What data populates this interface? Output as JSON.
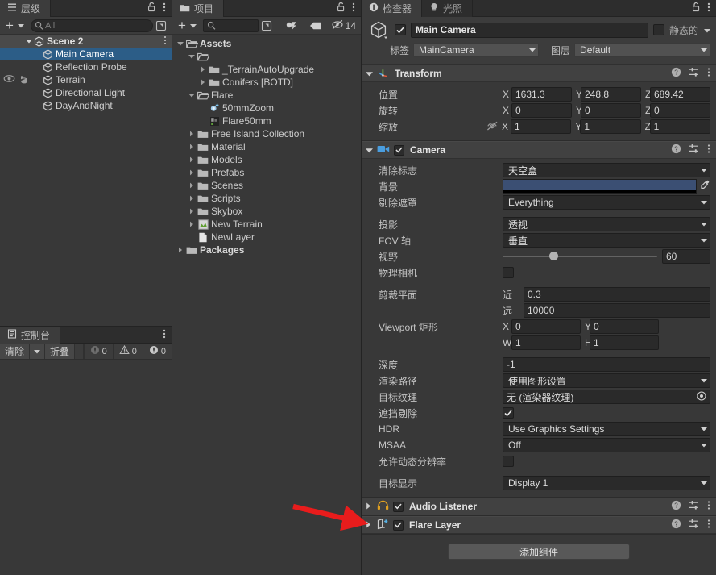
{
  "hierarchy": {
    "tab_label": "层级",
    "tab_icon": "hierarchy-icon",
    "lock_icon": "lock-open-icon",
    "menu_icon": "kebab-menu-icon",
    "add_label": "+",
    "search_placeholder": "All",
    "scene": {
      "label": "Scene 2",
      "icon": "unity-scene-icon"
    },
    "items": [
      {
        "label": "Main Camera",
        "icon": "gameobject-cube-icon",
        "selected": true,
        "vis": false
      },
      {
        "label": "Reflection Probe",
        "icon": "gameobject-cube-icon",
        "selected": false,
        "vis": false
      },
      {
        "label": "Terrain",
        "icon": "gameobject-cube-icon",
        "selected": false,
        "vis": true
      },
      {
        "label": "Directional Light",
        "icon": "gameobject-cube-icon",
        "selected": false,
        "vis": false
      },
      {
        "label": "DayAndNight",
        "icon": "gameobject-cube-icon",
        "selected": false,
        "vis": false
      }
    ]
  },
  "console": {
    "tab_label": "控制台",
    "tab_icon": "console-icon",
    "menu_icon": "kebab-menu-icon",
    "clear_label": "清除",
    "clear_dropdown_icon": "chevron-down-icon",
    "collapse_label": "折叠",
    "counters": [
      {
        "icon": "log-icon",
        "value": "0"
      },
      {
        "icon": "warning-icon",
        "value": "0"
      },
      {
        "icon": "error-icon",
        "value": "0"
      }
    ]
  },
  "project": {
    "tab_label": "项目",
    "tab_icon": "folder-icon",
    "lock_icon": "lock-open-icon",
    "menu_icon": "kebab-menu-icon",
    "add_label": "+",
    "search_placeholder": "",
    "filter_type_icon": "filter-by-type-icon",
    "filter_label_icon": "filter-by-label-icon",
    "hidden_icon": "eye-off-icon",
    "hidden_count": "14",
    "tree": [
      {
        "label": "Assets",
        "icon": "folder-open-icon",
        "indent": 0,
        "tw": "down",
        "bold": true
      },
      {
        "label": "",
        "icon": "folder-open-icon",
        "indent": 1,
        "tw": "down",
        "bold": false
      },
      {
        "label": "_TerrainAutoUpgrade",
        "icon": "folder-icon",
        "indent": 2,
        "tw": "right",
        "bold": false
      },
      {
        "label": "Conifers [BOTD]",
        "icon": "folder-icon",
        "indent": 2,
        "tw": "right",
        "bold": false
      },
      {
        "label": "Flare",
        "icon": "folder-open-icon",
        "indent": 1,
        "tw": "down",
        "bold": false
      },
      {
        "label": "50mmZoom",
        "icon": "flare-asset-icon",
        "indent": 2,
        "tw": "none",
        "bold": false
      },
      {
        "label": "Flare50mm",
        "icon": "texture-asset-icon",
        "indent": 2,
        "tw": "none",
        "bold": false
      },
      {
        "label": "Free Island Collection",
        "icon": "folder-icon",
        "indent": 1,
        "tw": "right",
        "bold": false
      },
      {
        "label": "Material",
        "icon": "folder-icon",
        "indent": 1,
        "tw": "right",
        "bold": false
      },
      {
        "label": "Models",
        "icon": "folder-icon",
        "indent": 1,
        "tw": "right",
        "bold": false
      },
      {
        "label": "Prefabs",
        "icon": "folder-icon",
        "indent": 1,
        "tw": "right",
        "bold": false
      },
      {
        "label": "Scenes",
        "icon": "folder-icon",
        "indent": 1,
        "tw": "right",
        "bold": false
      },
      {
        "label": "Scripts",
        "icon": "folder-icon",
        "indent": 1,
        "tw": "right",
        "bold": false
      },
      {
        "label": "Skybox",
        "icon": "folder-icon",
        "indent": 1,
        "tw": "right",
        "bold": false
      },
      {
        "label": "New Terrain",
        "icon": "terrain-asset-icon",
        "indent": 1,
        "tw": "right",
        "bold": false
      },
      {
        "label": "NewLayer",
        "icon": "file-asset-icon",
        "indent": 1,
        "tw": "none",
        "bold": false
      },
      {
        "label": "Packages",
        "icon": "folder-icon",
        "indent": 0,
        "tw": "right",
        "bold": true
      }
    ]
  },
  "inspector": {
    "tabs": [
      {
        "label": "检查器",
        "icon": "info-icon",
        "active": true
      },
      {
        "label": "光照",
        "icon": "light-icon",
        "active": false
      }
    ],
    "lock_icon": "lock-open-icon",
    "menu_icon": "kebab-menu-icon",
    "object_icon": "gameobject-cube-icon",
    "enabled": true,
    "name": "Main Camera",
    "static_label": "静态的",
    "static_checked": false,
    "tag_label": "标签",
    "tag_value": "MainCamera",
    "layer_label": "图层",
    "layer_value": "Default",
    "components": [
      {
        "name": "Transform",
        "icon": "transform-icon",
        "has_checkbox": false,
        "help_icon": "help-icon",
        "preset_icon": "preset-icon",
        "menu_icon": "kebab-menu-icon",
        "rows": [
          {
            "label": "位置",
            "x": "1631.3",
            "y": "248.8",
            "z": "689.42",
            "lock_icon": null
          },
          {
            "label": "旋转",
            "x": "0",
            "y": "0",
            "z": "0",
            "lock_icon": null
          },
          {
            "label": "缩放",
            "x": "1",
            "y": "1",
            "z": "1",
            "lock_icon": "constrain-proportions-off-icon"
          }
        ]
      },
      {
        "name": "Camera",
        "icon": "camera-icon",
        "has_checkbox": true,
        "enabled": true,
        "help_icon": "help-icon",
        "preset_icon": "preset-icon",
        "menu_icon": "kebab-menu-icon",
        "fields": [
          {
            "kind": "dropdown",
            "label": "清除标志",
            "value": "天空盒"
          },
          {
            "kind": "color",
            "label": "背景",
            "value": "#3b4f73",
            "eyedropper_icon": "eyedropper-icon"
          },
          {
            "kind": "dropdown",
            "label": "剔除遮罩",
            "value": "Everything"
          },
          {
            "kind": "gap"
          },
          {
            "kind": "dropdown",
            "label": "投影",
            "value": "透视"
          },
          {
            "kind": "dropdown",
            "label": "FOV 轴",
            "value": "垂直"
          },
          {
            "kind": "slider",
            "label": "视野",
            "value": "60",
            "min": 1,
            "max": 179
          },
          {
            "kind": "checkbox",
            "label": "物理相机",
            "checked": false
          },
          {
            "kind": "gap"
          },
          {
            "kind": "pair",
            "label": "剪裁平面",
            "sub1_label": "近",
            "sub1_value": "0.3",
            "sub2_label": "远",
            "sub2_value": "10000"
          },
          {
            "kind": "rect",
            "label": "Viewport 矩形",
            "x_label": "X",
            "x": "0",
            "y_label": "Y",
            "y": "0",
            "w_label": "W",
            "w": "1",
            "h_label": "H",
            "h": "1"
          },
          {
            "kind": "gap"
          },
          {
            "kind": "number",
            "label": "深度",
            "value": "-1"
          },
          {
            "kind": "dropdown",
            "label": "渲染路径",
            "value": "使用图形设置"
          },
          {
            "kind": "object",
            "label": "目标纹理",
            "value": "无 (渲染器纹理)",
            "picker_icon": "object-picker-icon"
          },
          {
            "kind": "checkbox",
            "label": "遮挡剔除",
            "checked": true
          },
          {
            "kind": "dropdown",
            "label": "HDR",
            "value": "Use Graphics Settings"
          },
          {
            "kind": "dropdown",
            "label": "MSAA",
            "value": "Off"
          },
          {
            "kind": "checkbox",
            "label": "允许动态分辨率",
            "checked": false
          },
          {
            "kind": "gap"
          },
          {
            "kind": "dropdown",
            "label": "目标显示",
            "value": "Display 1"
          }
        ]
      },
      {
        "name": "Audio Listener",
        "icon": "headphones-icon",
        "has_checkbox": true,
        "enabled": true,
        "collapsed": true,
        "help_icon": "help-icon",
        "preset_icon": "preset-icon",
        "menu_icon": "kebab-menu-icon"
      },
      {
        "name": "Flare Layer",
        "icon": "flare-layer-icon",
        "has_checkbox": true,
        "enabled": true,
        "collapsed": true,
        "help_icon": "help-icon",
        "preset_icon": "preset-icon",
        "menu_icon": "kebab-menu-icon"
      }
    ],
    "add_component_label": "添加组件"
  },
  "annotation": {
    "arrow_color": "#e81c1c",
    "arrow_name": "red-pointer-arrow"
  },
  "colors": {
    "selection_blue": "#2c5d87",
    "panel_bg": "#383838",
    "header_bg": "#3c3c3c",
    "component_header": "#414141"
  }
}
